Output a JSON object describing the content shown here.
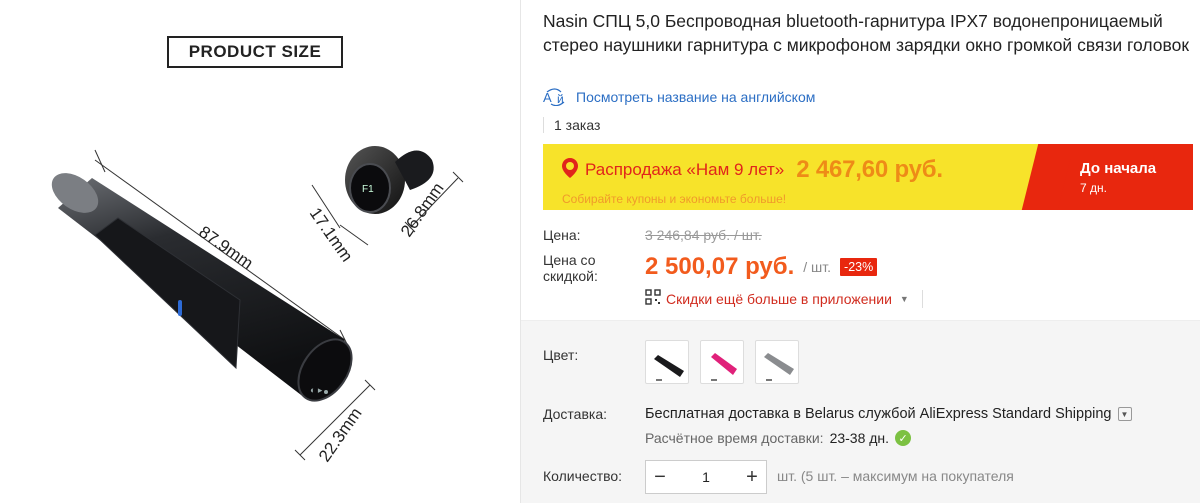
{
  "image": {
    "size_label": "PRODUCT SIZE",
    "dimensions": {
      "case_length": "87.9mm",
      "case_diameter": "22.3mm",
      "earbud_width": "17.1mm",
      "earbud_height": "26.8mm"
    }
  },
  "product": {
    "title": "Nasin СПЦ 5,0 Беспроводная bluetooth-гарнитура IPX7 водонепроницаемый стерео наушники гарнитура с микрофоном зарядки окно громкой связи головок",
    "translate_link": "Посмотреть название на английском",
    "orders": "1 заказ"
  },
  "promo": {
    "name": "Распродажа «Нам 9 лет»",
    "price": "2 467,60 руб.",
    "subtitle": "Собирайте купоны и экономьте больше!",
    "start_label": "До начала",
    "days": "7 дн."
  },
  "pricing": {
    "price_label": "Цена:",
    "old_price": "3 246,84 руб. / шт.",
    "discount_label_line1": "Цена со",
    "discount_label_line2": "скидкой:",
    "price": "2 500,07 руб.",
    "unit": "/ шт.",
    "discount": "-23%",
    "app_discount": "Скидки ещё больше в приложении"
  },
  "color": {
    "label": "Цвет:",
    "options": [
      "black",
      "pink",
      "gray"
    ]
  },
  "shipping": {
    "label": "Доставка:",
    "text": "Бесплатная доставка в Belarus службой AliExpress Standard Shipping",
    "eta_label": "Расчётное время доставки:",
    "eta_value": "23-38 дн."
  },
  "quantity": {
    "label": "Количество:",
    "minus": "−",
    "value": "1",
    "plus": "+",
    "note": "шт. (5 шт. – максимум на покупателя"
  },
  "colors": {
    "accent_red": "#e8270e",
    "promo_yellow": "#f7e32a",
    "price_orange": "#f25b1d",
    "link_blue": "#2b6ec4"
  }
}
